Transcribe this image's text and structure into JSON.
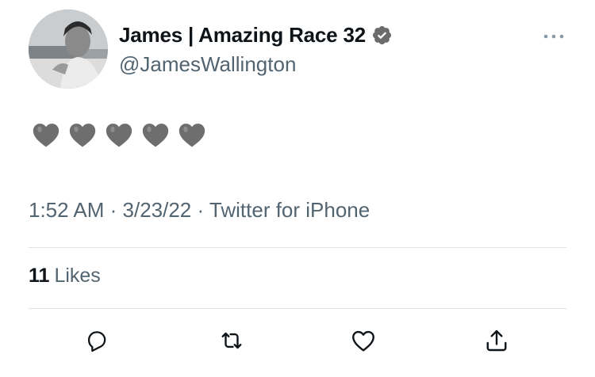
{
  "tweet": {
    "display_name": "James | Amazing Race 32",
    "handle": "@JamesWallington",
    "verified": true,
    "text": "🩶🩶🩶🩶🩶",
    "hearts_count": 5,
    "heart_color": "#6e6e6e",
    "meta": {
      "time": "1:52 AM",
      "date": "3/23/22",
      "source": "Twitter for iPhone",
      "separator": " · "
    },
    "likes": {
      "count": "11",
      "label": "Likes"
    },
    "actions": [
      {
        "name": "reply",
        "icon": "reply-icon"
      },
      {
        "name": "retweet",
        "icon": "retweet-icon"
      },
      {
        "name": "like",
        "icon": "heart-outline-icon"
      },
      {
        "name": "share",
        "icon": "share-icon"
      }
    ]
  },
  "colors": {
    "primary_text": "#0f1419",
    "secondary_text": "#536471",
    "divider": "#e1e4e6",
    "verified_badge": "#6b6b6b"
  }
}
